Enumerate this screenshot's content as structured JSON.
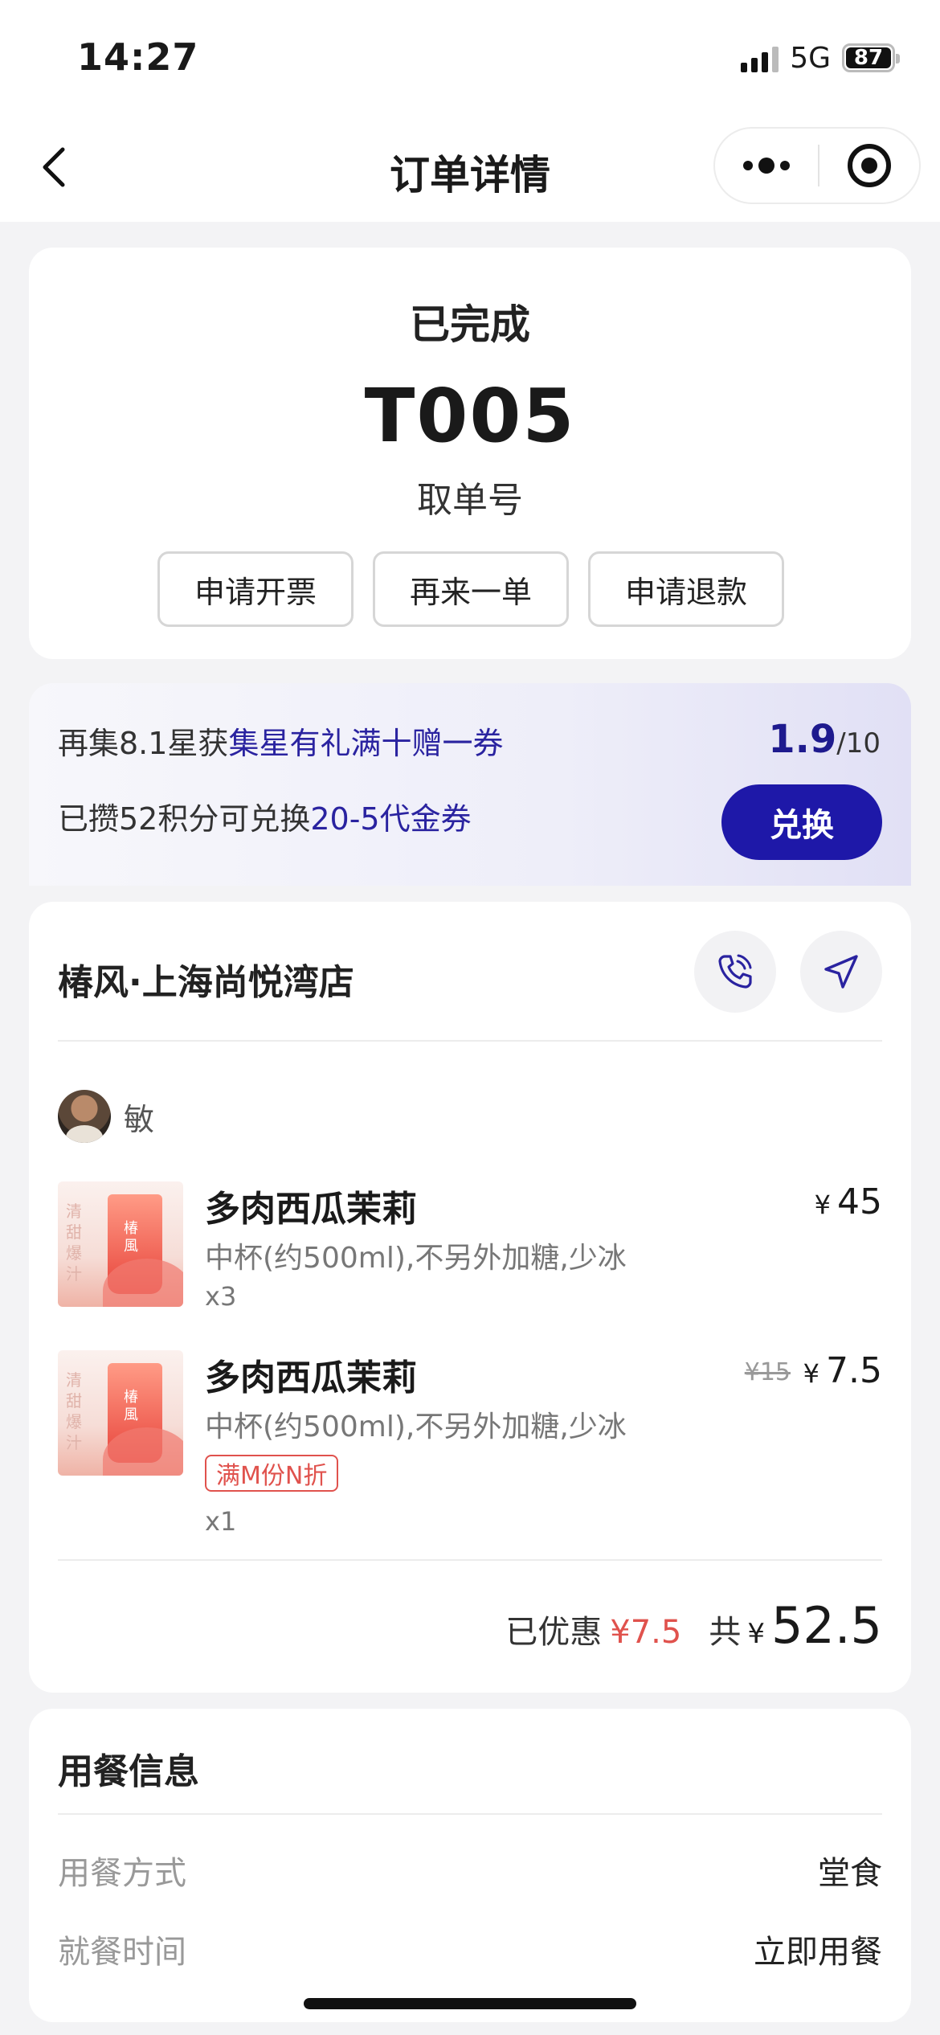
{
  "status_bar": {
    "time": "14:27",
    "network": "5G",
    "battery": "87"
  },
  "nav": {
    "title": "订单详情"
  },
  "order": {
    "status": "已完成",
    "pickup_number": "T005",
    "pickup_label": "取单号",
    "actions": [
      "申请开票",
      "再来一单",
      "申请退款"
    ]
  },
  "points": {
    "line1_prefix": "再集8.1星获",
    "line1_highlight": "集星有礼满十赠一券",
    "line2_prefix": "已攒52积分可兑换",
    "line2_highlight": "20-5代金券",
    "progress_value": "1.9",
    "progress_total": "/10",
    "redeem_label": "兑换",
    "accent_color": "#1e18a8"
  },
  "store": {
    "name": "椿风·上海尚悦湾店",
    "orderer": "敏",
    "items": [
      {
        "name": "多肉西瓜茉莉",
        "spec": "中杯(约500ml),不另外加糖,少冰",
        "qty": "x3",
        "currency": "¥",
        "price": "45"
      },
      {
        "name": "多肉西瓜茉莉",
        "spec": "中杯(约500ml),不另外加糖,少冰",
        "promo_tag": "满M份N折",
        "qty": "x1",
        "original_price": "¥15",
        "currency": "¥",
        "price": "7.5"
      }
    ],
    "thumb": {
      "side_text": "清甜爆汁",
      "cup_text": "椿風"
    },
    "summary": {
      "discount_label": "已优惠",
      "discount_value": "¥7.5",
      "total_label": "共",
      "currency": "¥",
      "total_value": "52.5"
    }
  },
  "dining": {
    "title": "用餐信息",
    "rows": [
      {
        "label": "用餐方式",
        "value": "堂食"
      },
      {
        "label": "就餐时间",
        "value": "立即用餐"
      }
    ]
  }
}
